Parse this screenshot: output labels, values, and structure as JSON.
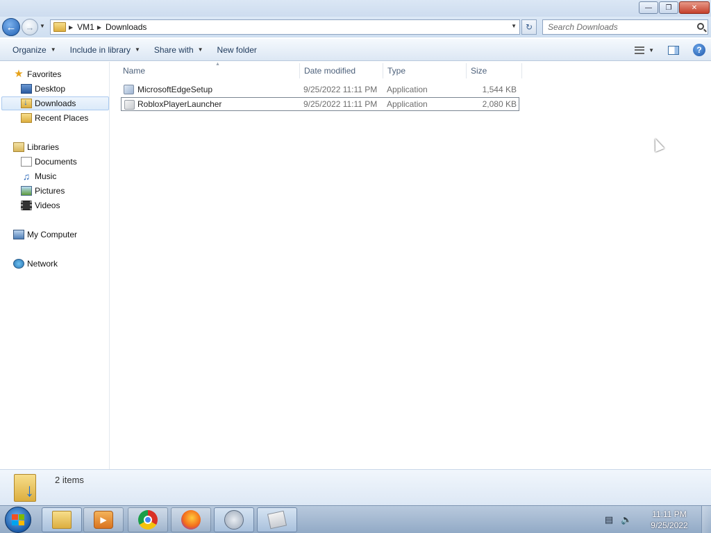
{
  "window": {
    "minimize_icon": "minimize-icon",
    "maximize_icon": "restore-icon",
    "close_icon": "close-icon"
  },
  "address": {
    "crumbs": [
      "VM1",
      "Downloads"
    ],
    "search_placeholder": "Search Downloads"
  },
  "toolbar": {
    "organize": "Organize",
    "include_in_library": "Include in library",
    "share_with": "Share with",
    "new_folder": "New folder"
  },
  "sidebar": {
    "favorites": {
      "label": "Favorites",
      "items": [
        "Desktop",
        "Downloads",
        "Recent Places"
      ],
      "selected": "Downloads"
    },
    "libraries": {
      "label": "Libraries",
      "items": [
        "Documents",
        "Music",
        "Pictures",
        "Videos"
      ]
    },
    "computer": "My Computer",
    "network": "Network"
  },
  "columns": {
    "name": "Name",
    "date_modified": "Date modified",
    "type": "Type",
    "size": "Size"
  },
  "files": [
    {
      "name": "MicrosoftEdgeSetup",
      "date": "9/25/2022 11:11 PM",
      "type": "Application",
      "size": "1,544 KB",
      "icon": "edge-setup-icon"
    },
    {
      "name": "RobloxPlayerLauncher",
      "date": "9/25/2022 11:11 PM",
      "type": "Application",
      "size": "2,080 KB",
      "icon": "roblox-icon"
    }
  ],
  "details": {
    "count": "2 items"
  },
  "taskbar": {
    "apps": [
      "windows-explorer-icon",
      "media-player-icon",
      "chrome-icon",
      "firefox-icon",
      "installer-disc-icon",
      "roblox-icon"
    ],
    "clock_time": "11:11 PM",
    "clock_date": "9/25/2022"
  },
  "colors": {
    "selection": "#dbeaf9",
    "accent": "#1e395b"
  }
}
